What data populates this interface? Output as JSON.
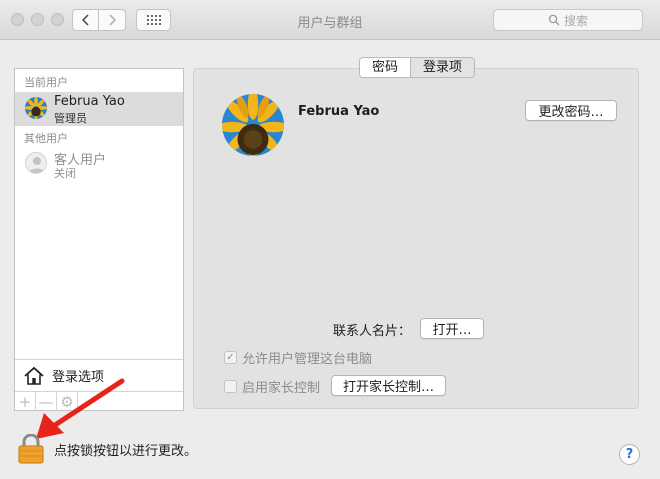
{
  "window": {
    "title": "用户与群组",
    "search_placeholder": "搜索"
  },
  "sidebar": {
    "current_users_label": "当前用户",
    "other_users_label": "其他用户",
    "users": [
      {
        "name": "Februa Yao",
        "role": "管理员"
      },
      {
        "name": "客人用户",
        "role": "关闭"
      }
    ],
    "login_options_label": "登录选项",
    "add_symbol": "+",
    "remove_symbol": "—",
    "settings_symbol": "⚙"
  },
  "tabs": [
    {
      "label": "密码"
    },
    {
      "label": "登录项"
    }
  ],
  "main": {
    "full_name": "Februa Yao",
    "change_password_label": "更改密码…",
    "contact_card_label": "联系人名片：",
    "open_label": "打开…",
    "allow_admin_label": "允许用户管理这台电脑",
    "allow_admin_checked": true,
    "parental_controls_label": "启用家长控制",
    "parental_controls_checked": false,
    "open_parental_label": "打开家长控制…"
  },
  "footer": {
    "lock_message": "点按锁按钮以进行更改。",
    "help_symbol": "?"
  },
  "icons": {
    "back": "chevron-left-icon",
    "forward": "chevron-right-icon",
    "grid": "grid-icon",
    "search": "search-icon",
    "home": "house-icon",
    "lock": "lock-icon",
    "guest": "person-icon"
  },
  "colors": {
    "accent": "#2a72d8",
    "arrow": "#e8231a",
    "lock": "#f0a12b"
  }
}
